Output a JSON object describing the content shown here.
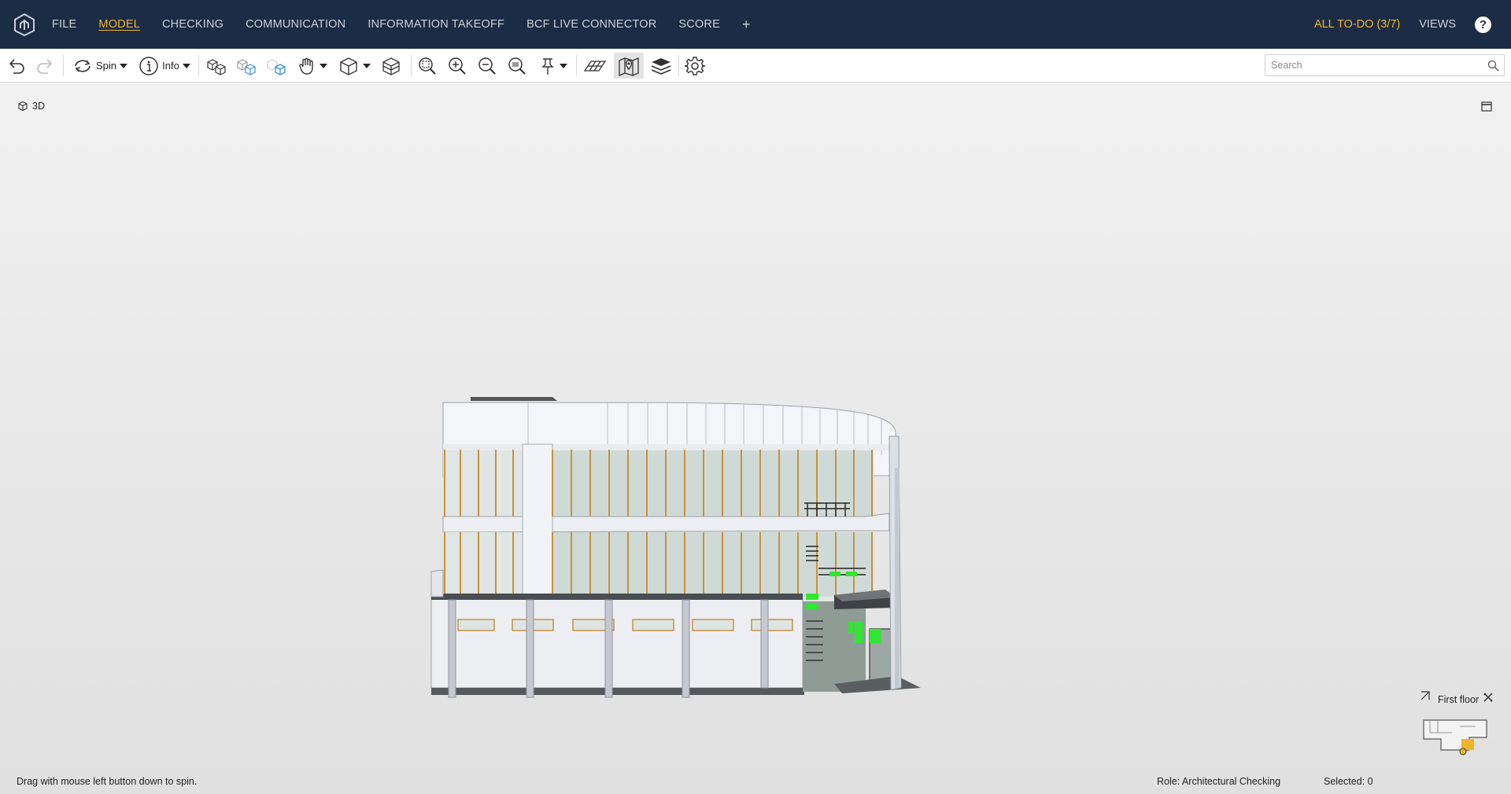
{
  "nav": {
    "items": [
      {
        "label": "FILE",
        "active": false
      },
      {
        "label": "MODEL",
        "active": true
      },
      {
        "label": "CHECKING",
        "active": false
      },
      {
        "label": "COMMUNICATION",
        "active": false
      },
      {
        "label": "INFORMATION TAKEOFF",
        "active": false
      },
      {
        "label": "BCF LIVE CONNECTOR",
        "active": false
      },
      {
        "label": "SCORE",
        "active": false
      }
    ],
    "plus": "+",
    "todo": "ALL TO-DO (3/7)",
    "views": "VIEWS",
    "help": "?"
  },
  "toolbar": {
    "spin_label": "Spin",
    "info_label": "Info",
    "search_placeholder": "Search"
  },
  "viewport": {
    "label": "3D"
  },
  "minimap": {
    "title": "First floor"
  },
  "status": {
    "hint": "Drag with mouse left button down to spin.",
    "role": "Role: Architectural Checking",
    "selected": "Selected: 0"
  },
  "colors": {
    "nav_bg": "#1c2c44",
    "accent": "#f0b429",
    "window_frame": "#c9913f",
    "highlight": "#2ee82e"
  }
}
